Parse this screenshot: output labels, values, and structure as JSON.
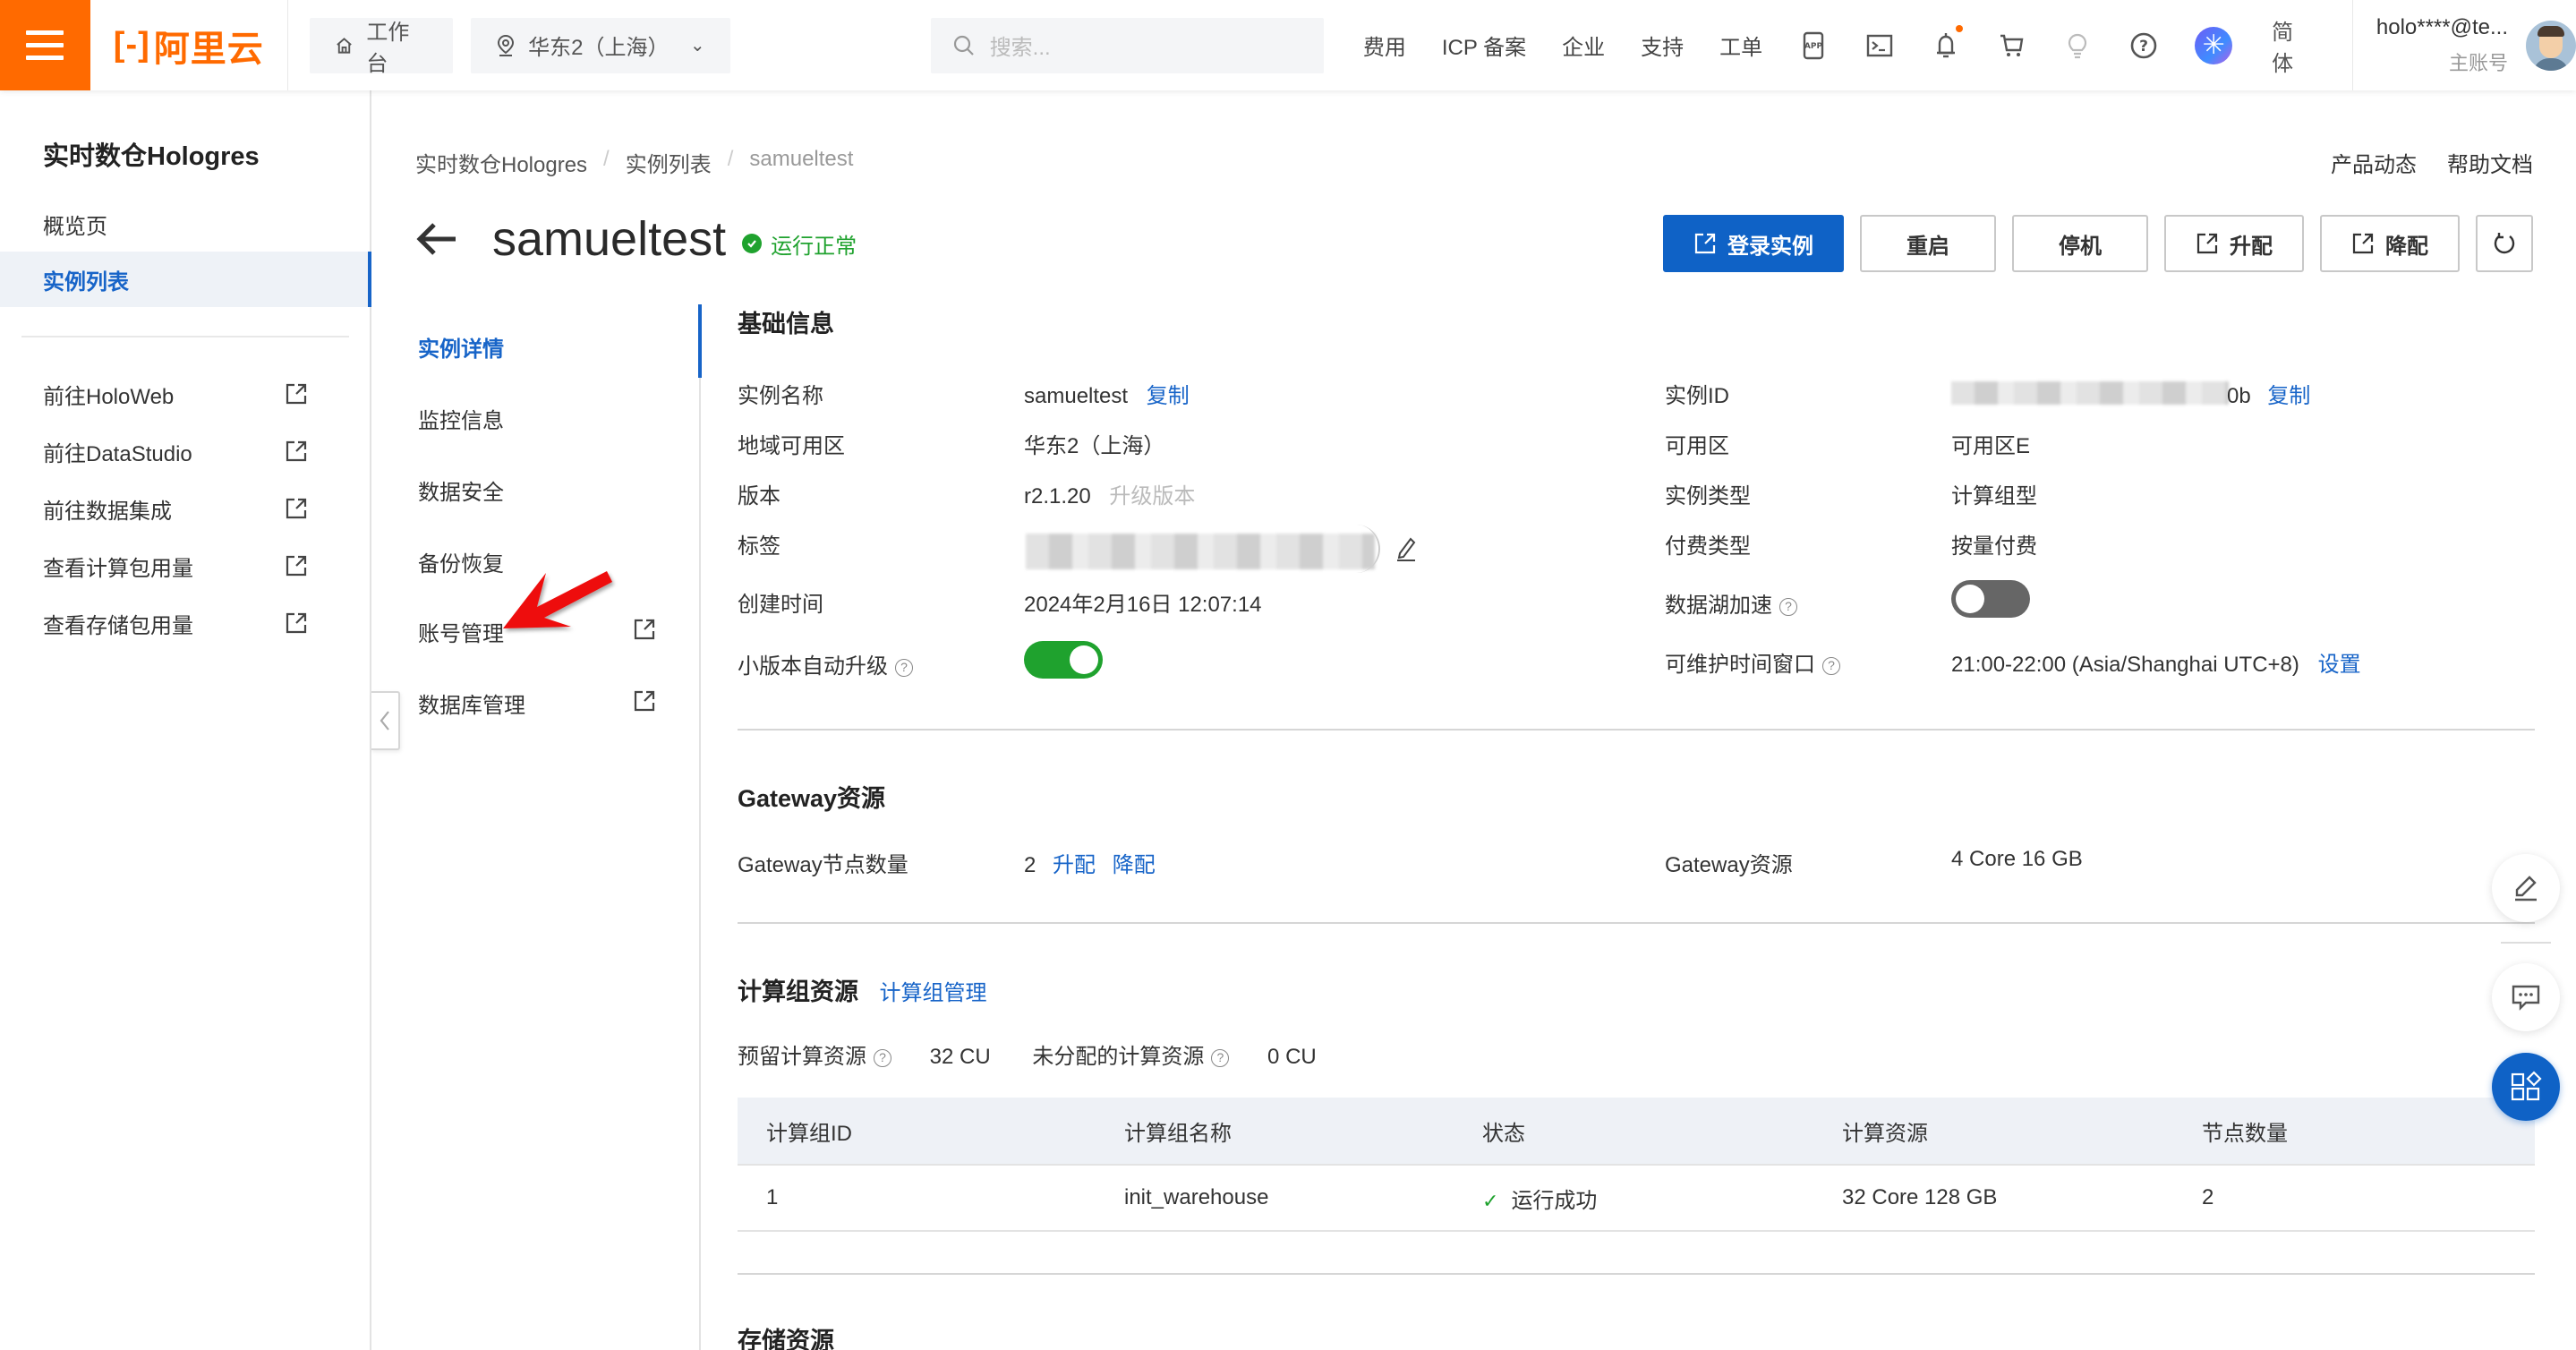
{
  "header": {
    "logo_text": "阿里云",
    "workbench": "工作台",
    "region": "华东2（上海）",
    "search_placeholder": "搜索...",
    "nav": [
      "费用",
      "ICP 备案",
      "企业",
      "支持",
      "工单"
    ],
    "icons": [
      "app-icon",
      "terminal-icon",
      "bell-icon",
      "cart-icon",
      "bulb-icon",
      "help-icon",
      "ai-assistant-icon"
    ],
    "notification_dot": true,
    "language": "简体",
    "account_name": "holo****@te...",
    "account_role": "主账号"
  },
  "sidebar": {
    "title": "实时数仓Hologres",
    "items": [
      {
        "label": "概览页",
        "active": false
      },
      {
        "label": "实例列表",
        "active": true
      }
    ],
    "links": [
      "前往HoloWeb",
      "前往DataStudio",
      "前往数据集成",
      "查看计算包用量",
      "查看存储包用量"
    ]
  },
  "breadcrumb": [
    "实时数仓Hologres",
    "实例列表",
    "samueltest"
  ],
  "page_links": [
    "产品动态",
    "帮助文档"
  ],
  "instance": {
    "title": "samueltest",
    "status": "运行正常",
    "status_color": "#1fa22e"
  },
  "actions": {
    "login": "登录实例",
    "restart": "重启",
    "stop": "停机",
    "upgrade": "升配",
    "downgrade": "降配"
  },
  "subnav": {
    "items": [
      {
        "label": "实例详情",
        "active": true,
        "external": false
      },
      {
        "label": "监控信息",
        "active": false,
        "external": false
      },
      {
        "label": "数据安全",
        "active": false,
        "external": false
      },
      {
        "label": "备份恢复",
        "active": false,
        "external": false
      },
      {
        "label": "账号管理",
        "active": false,
        "external": true
      },
      {
        "label": "数据库管理",
        "active": false,
        "external": true
      }
    ]
  },
  "basic_info": {
    "title": "基础信息",
    "left": [
      {
        "label": "实例名称",
        "value": "samueltest",
        "action": "复制"
      },
      {
        "label": "地域可用区",
        "value": "华东2（上海）"
      },
      {
        "label": "版本",
        "value": "r2.1.20",
        "action_disabled": "升级版本"
      },
      {
        "label": "标签",
        "value": "(redacted)"
      },
      {
        "label": "创建时间",
        "value": "2024年2月16日 12:07:14"
      },
      {
        "label": "小版本自动升级",
        "toggle": true
      }
    ],
    "right": [
      {
        "label": "实例ID",
        "value_suffix": "0b",
        "action": "复制"
      },
      {
        "label": "可用区",
        "value": "可用区E"
      },
      {
        "label": "实例类型",
        "value": "计算组型"
      },
      {
        "label": "付费类型",
        "value": "按量付费"
      },
      {
        "label": "数据湖加速",
        "toggle": false
      },
      {
        "label": "可维护时间窗口",
        "value": "21:00-22:00 (Asia/Shanghai UTC+8)",
        "action": "设置"
      }
    ]
  },
  "gateway": {
    "title": "Gateway资源",
    "node_label": "Gateway节点数量",
    "node_value": "2",
    "node_actions": [
      "升配",
      "降配"
    ],
    "res_label": "Gateway资源",
    "res_value": "4 Core 16 GB"
  },
  "compute": {
    "title": "计算组资源",
    "manage_link": "计算组管理",
    "reserved_label": "预留计算资源",
    "reserved_value": "32 CU",
    "unalloc_label": "未分配的计算资源",
    "unalloc_value": "0 CU",
    "columns": [
      "计算组ID",
      "计算组名称",
      "状态",
      "计算资源",
      "节点数量"
    ],
    "rows": [
      {
        "id": "1",
        "name": "init_warehouse",
        "status": "运行成功",
        "resource": "32 Core 128 GB",
        "nodes": "2"
      }
    ]
  },
  "storage": {
    "title": "存储资源"
  },
  "colors": {
    "brand_orange": "#ff6a00",
    "primary_blue": "#0f62c6",
    "link_blue": "#1764c8",
    "success_green": "#1fa22e"
  }
}
